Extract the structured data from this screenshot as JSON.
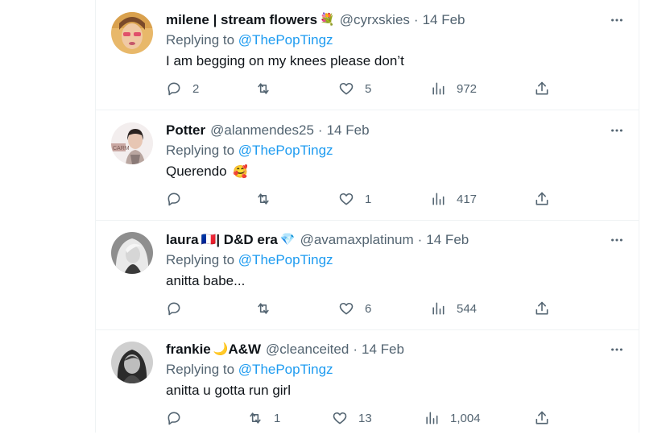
{
  "replying_prefix": "Replying to",
  "tweets": [
    {
      "display_name": "milene | stream flowers",
      "name_emoji": "💐",
      "handle": "@cyrxskies",
      "sep": "·",
      "date": "14 Feb",
      "reply_to": "@ThePopTingz",
      "text": "I am begging on my knees please don’t",
      "text_emoji": "",
      "replies": "2",
      "retweets": "",
      "likes": "5",
      "views": "972"
    },
    {
      "display_name": "Potter",
      "name_emoji": "",
      "handle": "@alanmendes25",
      "sep": "·",
      "date": "14 Feb",
      "reply_to": "@ThePopTingz",
      "text": "Querendo",
      "text_emoji": "🥰",
      "replies": "",
      "retweets": "",
      "likes": "1",
      "views": "417"
    },
    {
      "display_name": "laura",
      "name_flag": "🇫🇷",
      "name_suffix": " | D&D era",
      "name_emoji": "💎",
      "handle": "@avamaxplatinum",
      "sep": "·",
      "date": "14 Feb",
      "reply_to": "@ThePopTingz",
      "text": "anitta babe...",
      "text_emoji": "",
      "replies": "",
      "retweets": "",
      "likes": "6",
      "views": "544"
    },
    {
      "display_name": "frankie",
      "name_emoji": "🌙",
      "name_suffix": " A&W",
      "handle": "@cleanceited",
      "sep": "·",
      "date": "14 Feb",
      "reply_to": "@ThePopTingz",
      "text": "anitta u gotta run girl",
      "text_emoji": "",
      "replies": "",
      "retweets": "1",
      "likes": "13",
      "views": "1,004"
    }
  ],
  "icons": {
    "reply": "reply-icon",
    "retweet": "retweet-icon",
    "like": "heart-icon",
    "views": "views-icon",
    "share": "share-icon",
    "more": "more-icon"
  },
  "colors": {
    "link": "#1d9bf0",
    "muted": "#536471",
    "text": "#0f1419",
    "divider": "#eff3f4"
  }
}
